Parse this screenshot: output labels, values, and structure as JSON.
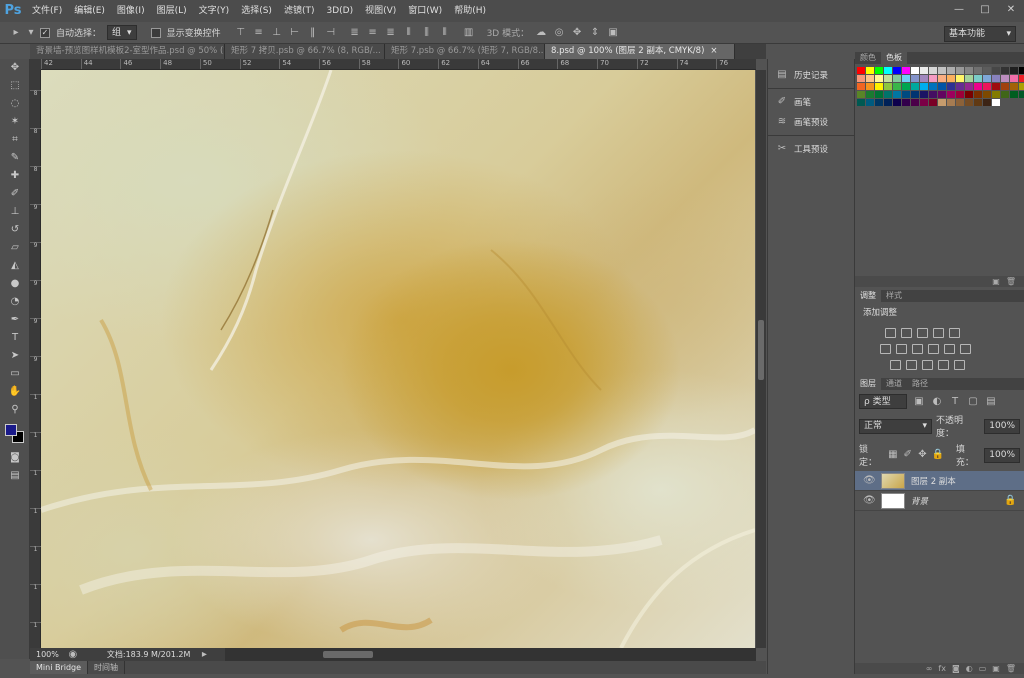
{
  "app": {
    "logo": "Ps"
  },
  "menu": [
    "文件(F)",
    "编辑(E)",
    "图像(I)",
    "图层(L)",
    "文字(Y)",
    "选择(S)",
    "滤镜(T)",
    "3D(D)",
    "视图(V)",
    "窗口(W)",
    "帮助(H)"
  ],
  "window_controls": {
    "minimize": "—",
    "maximize": "□",
    "close": "✕"
  },
  "options": {
    "auto_select_label": "自动选择：",
    "auto_select_value": "组",
    "show_transform_label": "显示变换控件",
    "mode_3d_label": "3D 模式：",
    "workspace": "基本功能"
  },
  "tabs": [
    {
      "label": "背景墙-预览图样机模板2-室型作品.psd @ 50% (第二..."
    },
    {
      "label": "矩形 7 拷贝.psb @ 66.7% (8, RGB/..."
    },
    {
      "label": "矩形 7.psb @ 66.7% (矩形 7, RGB/8..."
    },
    {
      "label": "8.psd @ 100% (图层 2 副本, CMYK/8)"
    }
  ],
  "tab_close": "×",
  "ruler_h": [
    "42",
    "44",
    "46",
    "48",
    "50",
    "52",
    "54",
    "56",
    "58",
    "60",
    "62",
    "64",
    "66",
    "68",
    "70",
    "72",
    "74",
    "76"
  ],
  "ruler_v": [
    "8",
    "8",
    "8",
    "9",
    "9",
    "9",
    "9",
    "9",
    "1",
    "1",
    "1",
    "1",
    "1",
    "1",
    "1"
  ],
  "status": {
    "zoom": "100%",
    "doc": "文档:183.9 M/201.2M"
  },
  "bottom_tabs": [
    "Mini Bridge",
    "时间轴"
  ],
  "mid_panel": {
    "history": "历史记录",
    "brush": "画笔",
    "brush_preset": "画笔预设",
    "tool_preset": "工具预设"
  },
  "color_panel": {
    "tabs": [
      "颜色",
      "色板"
    ],
    "active": 1
  },
  "adjust_panel": {
    "tabs": [
      "调整",
      "样式"
    ],
    "active": 0,
    "title": "添加调整"
  },
  "layers_panel": {
    "tabs": [
      "图层",
      "通道",
      "路径"
    ],
    "filter_kind": "ρ 类型",
    "blend_mode": "正常",
    "opacity_label": "不透明度：",
    "opacity_value": "100%",
    "lock_label": "锁定：",
    "fill_label": "填充：",
    "fill_value": "100%",
    "layers": [
      {
        "name": "图层 2 副本",
        "selected": true
      },
      {
        "name": "背景",
        "selected": false,
        "locked": true
      }
    ]
  },
  "tools": [
    "move-icon",
    "marquee-icon",
    "lasso-icon",
    "magic-wand-icon",
    "crop-icon",
    "eyedropper-icon",
    "healing-icon",
    "brush-icon",
    "stamp-icon",
    "history-brush-icon",
    "eraser-icon",
    "bucket-icon",
    "blur-icon",
    "dodge-icon",
    "pen-icon",
    "type-icon",
    "path-select-icon",
    "shape-icon",
    "hand-icon",
    "zoom-icon"
  ],
  "colors": {
    "foreground": "#1a1a8a",
    "background": "#000000",
    "selected_layer": "#5e6e87",
    "accent": "#4fa3e0"
  },
  "swatch_colors": [
    "#ff0000",
    "#ffff00",
    "#00ff00",
    "#00ffff",
    "#0000ff",
    "#ff00ff",
    "#ffffff",
    "#ebebeb",
    "#d6d6d6",
    "#c2c2c2",
    "#adadad",
    "#999999",
    "#858585",
    "#707070",
    "#5c5c5c",
    "#474747",
    "#333333",
    "#1f1f1f",
    "#000000",
    "#f7977a",
    "#fdc68a",
    "#fff79a",
    "#c4df9b",
    "#82ca9c",
    "#6ecff6",
    "#8493ca",
    "#a187be",
    "#f49ac2",
    "#f9ad81",
    "#fbaf5d",
    "#fff468",
    "#a3d39c",
    "#7accc8",
    "#7ea7d8",
    "#8882be",
    "#bc8dbf",
    "#f06ea9",
    "#ed1c24",
    "#f26522",
    "#f7941d",
    "#fff200",
    "#8dc63f",
    "#39b54a",
    "#00a651",
    "#00a99d",
    "#00aeef",
    "#0072bc",
    "#0054a6",
    "#2e3192",
    "#662d91",
    "#92278f",
    "#ec008c",
    "#ed145b",
    "#9e0b0f",
    "#a0410d",
    "#a36209",
    "#aba000",
    "#598527",
    "#197b30",
    "#007236",
    "#00746b",
    "#0076a3",
    "#004a80",
    "#003471",
    "#1b1464",
    "#440e62",
    "#630460",
    "#9e005d",
    "#9e0039",
    "#790000",
    "#7b2e00",
    "#7d4900",
    "#827b00",
    "#406618",
    "#005e20",
    "#005826",
    "#005952",
    "#005b7f",
    "#003663",
    "#002157",
    "#0d004c",
    "#32004b",
    "#4b0049",
    "#7b0046",
    "#7a0026",
    "#c69c6d",
    "#a67c52",
    "#8c6239",
    "#754c24",
    "#603913",
    "#3c2415",
    "#ffffff"
  ]
}
